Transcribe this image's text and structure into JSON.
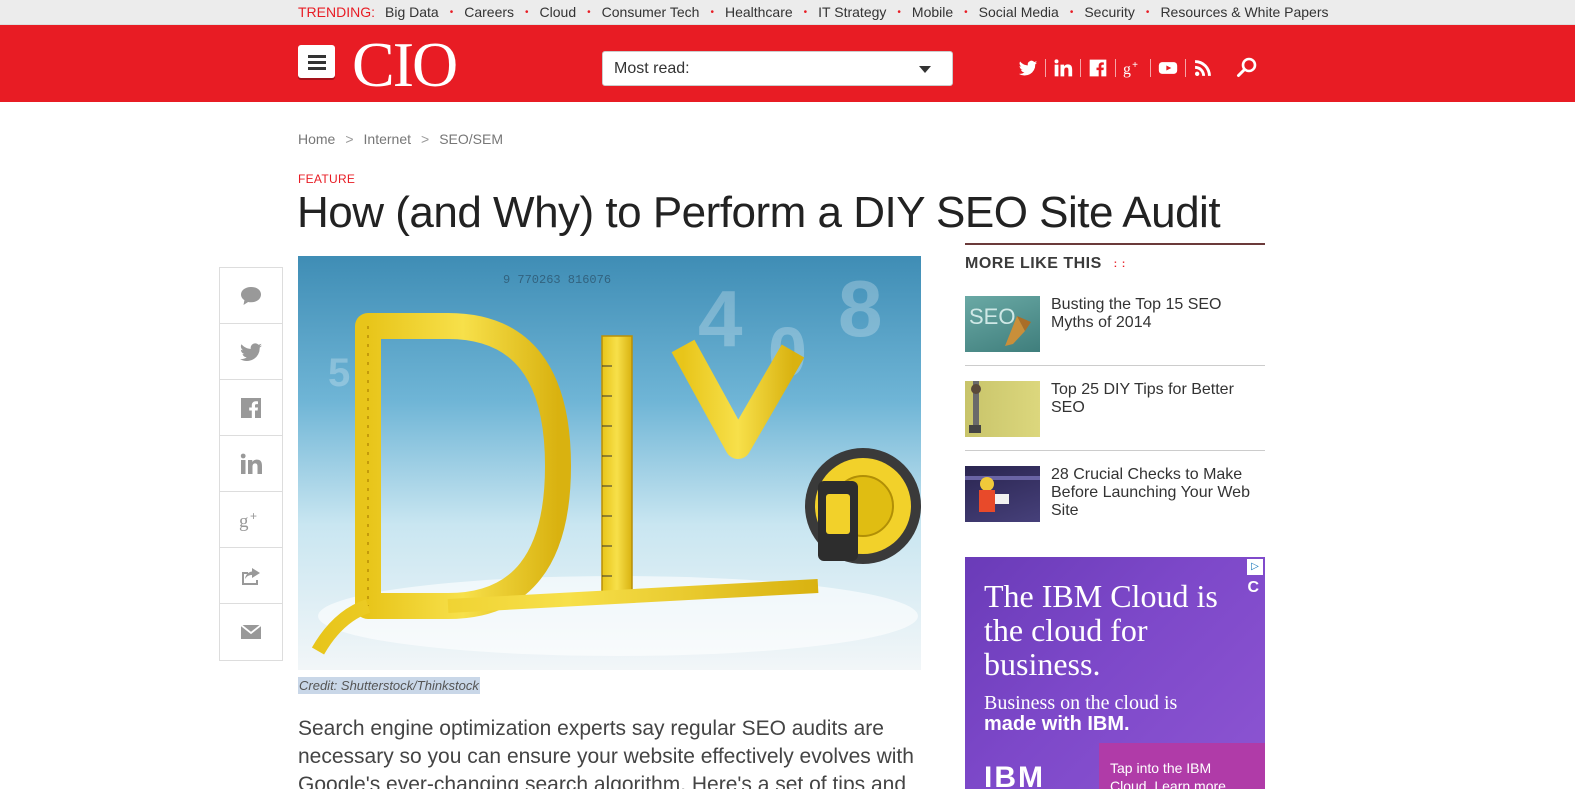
{
  "trending": {
    "label": "TRENDING:",
    "items": [
      "Big Data",
      "Careers",
      "Cloud",
      "Consumer Tech",
      "Healthcare",
      "IT Strategy",
      "Mobile",
      "Social Media",
      "Security",
      "Resources & White Papers"
    ]
  },
  "header": {
    "logo": "CIO",
    "most_read_label": "Most read:",
    "brand_color": "#e81c24"
  },
  "breadcrumb": [
    "Home",
    "Internet",
    "SEO/SEM"
  ],
  "article": {
    "kicker": "FEATURE",
    "title": "How (and Why) to Perform a DIY SEO Site Audit",
    "caption": "Credit: Shutterstock/Thinkstock",
    "intro": "Search engine optimization experts say regular SEO audits are necessary so you can ensure your website effectively evolves with Google's ever-changing search algorithm. Here's a set of tips and tricks for do-it-"
  },
  "hero": {
    "letters": "DIY",
    "number_strip": "9 770263 816076"
  },
  "more_like_this": {
    "title": "MORE LIKE THIS",
    "items": [
      {
        "title": "Busting the Top 15 SEO Myths of 2014",
        "thumb_text": "SEO"
      },
      {
        "title": "Top 25 DIY Tips for Better SEO"
      },
      {
        "title": "28 Crucial Checks to Make Before Launching Your Web Site"
      }
    ]
  },
  "ad": {
    "headline": "The IBM Cloud is the cloud for business.",
    "sub_plain": "Business on the cloud is",
    "sub_bold": "made with IBM.",
    "cta": "Tap into the IBM Cloud. Learn more",
    "brand": "IBM",
    "color": "#7d48c9"
  }
}
